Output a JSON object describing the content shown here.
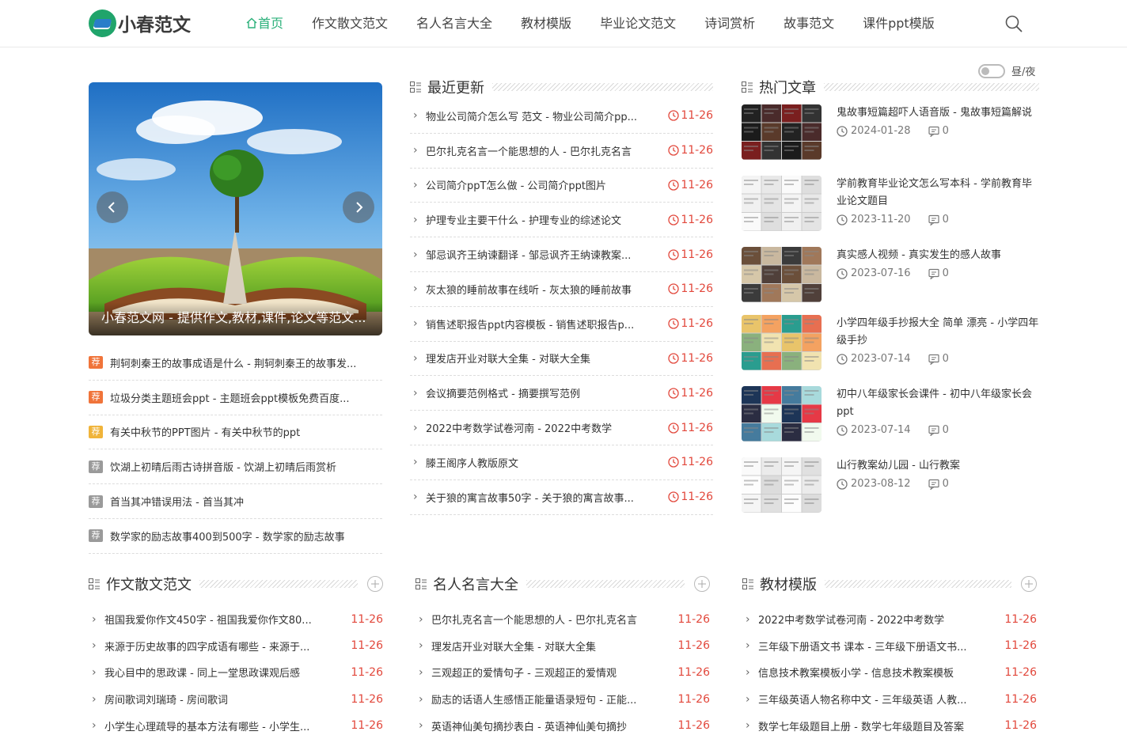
{
  "site": {
    "logo_text": "小春范文"
  },
  "nav": {
    "items": [
      "首页",
      "作文散文范文",
      "名人名言大全",
      "教材模版",
      "毕业论文范文",
      "诗词赏析",
      "故事范文",
      "课件ppt模版"
    ],
    "active_index": 0
  },
  "toggle": {
    "label": "昼/夜"
  },
  "slider": {
    "caption": "小春范文网 - 提供作文,教材,课件,论文等范文..."
  },
  "recommend": {
    "tag": "荐",
    "items": [
      {
        "text": "荆轲刺秦王的故事成语是什么 - 荆轲刺秦王的故事发...",
        "color": "#f0743a"
      },
      {
        "text": "垃圾分类主题班会ppt - 主题班会ppt模板免费百度...",
        "color": "#f0743a"
      },
      {
        "text": "有关中秋节的PPT图片 - 有关中秋节的ppt",
        "color": "#f0b43a"
      },
      {
        "text": "饮湖上初晴后雨古诗拼音版 - 饮湖上初晴后雨赏析",
        "color": "#9a9a9a"
      },
      {
        "text": "首当其冲错误用法 - 首当其冲",
        "color": "#9a9a9a"
      },
      {
        "text": "数学家的励志故事400到500字 - 数学家的励志故事",
        "color": "#9a9a9a"
      }
    ]
  },
  "latest": {
    "title": "最近更新",
    "items": [
      {
        "text": "物业公司简介怎么写 范文 - 物业公司简介pp...",
        "date": "11-26"
      },
      {
        "text": "巴尔扎克名言一个能思想的人 - 巴尔扎克名言",
        "date": "11-26"
      },
      {
        "text": "公司简介ppT怎么做 - 公司简介ppt图片",
        "date": "11-26"
      },
      {
        "text": "护理专业主要干什么 - 护理专业的综述论文",
        "date": "11-26"
      },
      {
        "text": "邹忌讽齐王纳谏翻译 - 邹忌讽齐王纳谏教案...",
        "date": "11-26"
      },
      {
        "text": "灰太狼的睡前故事在线听 - 灰太狼的睡前故事",
        "date": "11-26"
      },
      {
        "text": "销售述职报告ppt内容模板 - 销售述职报告p...",
        "date": "11-26"
      },
      {
        "text": "理发店开业对联大全集 - 对联大全集",
        "date": "11-26"
      },
      {
        "text": "会议摘要范例格式 - 摘要撰写范例",
        "date": "11-26"
      },
      {
        "text": "2022中考数学试卷河南 - 2022中考数学",
        "date": "11-26"
      },
      {
        "text": "滕王阁序人教版原文",
        "date": "11-26"
      },
      {
        "text": "关于狼的寓言故事50字 - 关于狼的寓言故事...",
        "date": "11-26"
      }
    ]
  },
  "hot": {
    "title": "热门文章",
    "items": [
      {
        "title": "鬼故事短篇超吓人语音版 - 鬼故事短篇解说",
        "date": "2024-01-28",
        "comments": "0"
      },
      {
        "title": "学前教育毕业论文怎么写本科 - 学前教育毕业论文题目",
        "date": "2023-11-20",
        "comments": "0"
      },
      {
        "title": "真实感人视频 - 真实发生的感人故事",
        "date": "2023-07-16",
        "comments": "0"
      },
      {
        "title": "小学四年级手抄报大全 简单 漂亮 - 小学四年级手抄",
        "date": "2023-07-14",
        "comments": "0"
      },
      {
        "title": "初中八年级家长会课件 - 初中八年级家长会ppt",
        "date": "2023-07-14",
        "comments": "0"
      },
      {
        "title": "山行教案幼儿园 - 山行教案",
        "date": "2023-08-12",
        "comments": "0"
      }
    ]
  },
  "columns": [
    {
      "title": "作文散文范文",
      "items": [
        {
          "text": "祖国我爱你作文450字 - 祖国我爱你作文80...",
          "date": "11-26"
        },
        {
          "text": "来源于历史故事的四字成语有哪些 - 来源于...",
          "date": "11-26"
        },
        {
          "text": "我心目中的思政课 - 同上一堂思政课观后感",
          "date": "11-26"
        },
        {
          "text": "房间歌词刘瑞琦 - 房间歌词",
          "date": "11-26"
        },
        {
          "text": "小学生心理疏导的基本方法有哪些 - 小学生...",
          "date": "11-26"
        }
      ]
    },
    {
      "title": "名人名言大全",
      "items": [
        {
          "text": "巴尔扎克名言一个能思想的人 - 巴尔扎克名言",
          "date": "11-26"
        },
        {
          "text": "理发店开业对联大全集 - 对联大全集",
          "date": "11-26"
        },
        {
          "text": "三观超正的爱情句子 - 三观超正的爱情观",
          "date": "11-26"
        },
        {
          "text": "励志的话语人生感悟正能量语录短句 - 正能...",
          "date": "11-26"
        },
        {
          "text": "英语神仙美句摘抄表白 - 英语神仙美句摘抄",
          "date": "11-26"
        }
      ]
    },
    {
      "title": "教材模版",
      "items": [
        {
          "text": "2022中考数学试卷河南 - 2022中考数学",
          "date": "11-26"
        },
        {
          "text": "三年级下册语文书 课本 - 三年级下册语文书...",
          "date": "11-26"
        },
        {
          "text": "信息技术教案模板小学 - 信息技术教案模板",
          "date": "11-26"
        },
        {
          "text": "三年级英语人物名称中文 - 三年级英语 人教...",
          "date": "11-26"
        },
        {
          "text": "数学七年级题目上册 - 数学七年级题目及答案",
          "date": "11-26"
        }
      ]
    }
  ]
}
